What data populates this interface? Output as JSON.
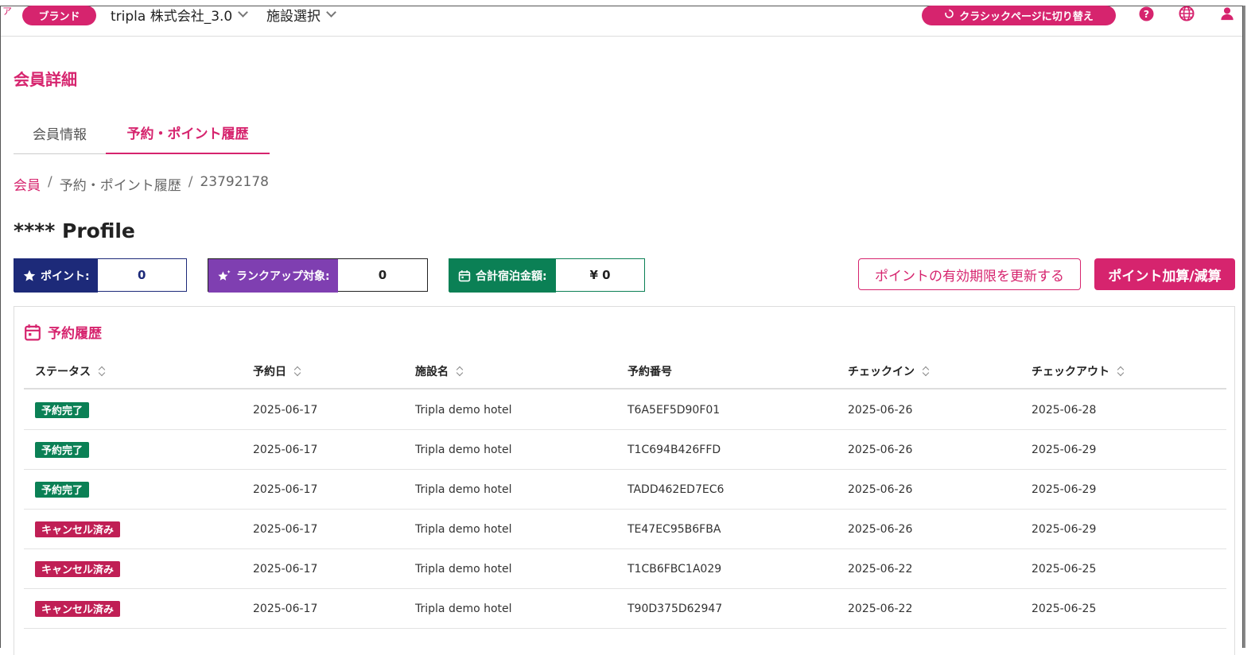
{
  "topbar": {
    "corner_mark": "ア",
    "brand_label": "ブランド",
    "tenant_select": "tripla 株式会社_3.0",
    "facility_select": "施設選択",
    "classic_button": "クラシックページに切り替え",
    "icons": [
      "help-icon",
      "globe-icon",
      "user-icon"
    ]
  },
  "page": {
    "title": "会員詳細",
    "tabs": [
      {
        "label": "会員情報",
        "active": false
      },
      {
        "label": "予約・ポイント履歴",
        "active": true
      }
    ],
    "breadcrumb": [
      "会員",
      "予約・ポイント履歴",
      "23792178"
    ],
    "profile_title": "**** Profile"
  },
  "stats": {
    "points": {
      "label": "ポイント:",
      "value": "0",
      "color": "#1d2a79"
    },
    "rankup": {
      "label": "ランクアップ対象:",
      "value": "0",
      "color": "#7f3fb1"
    },
    "stay_total": {
      "label": "合計宿泊金額:",
      "value": "¥ 0",
      "color": "#0b8055"
    }
  },
  "actions": {
    "extend_points": "ポイントの有効期限を更新する",
    "adjust_points": "ポイント加算/減算"
  },
  "history": {
    "title": "予約履歴",
    "columns": [
      "ステータス",
      "予約日",
      "施設名",
      "予約番号",
      "チェックイン",
      "チェックアウト"
    ],
    "rows": [
      {
        "status": "予約完了",
        "status_type": "done",
        "booked": "2025-06-17",
        "hotel": "Tripla demo hotel",
        "number": "T6A5EF5D90F01",
        "checkin": "2025-06-26",
        "checkout": "2025-06-28"
      },
      {
        "status": "予約完了",
        "status_type": "done",
        "booked": "2025-06-17",
        "hotel": "Tripla demo hotel",
        "number": "T1C694B426FFD",
        "checkin": "2025-06-26",
        "checkout": "2025-06-29"
      },
      {
        "status": "予約完了",
        "status_type": "done",
        "booked": "2025-06-17",
        "hotel": "Tripla demo hotel",
        "number": "TADD462ED7EC6",
        "checkin": "2025-06-26",
        "checkout": "2025-06-29"
      },
      {
        "status": "キャンセル済み",
        "status_type": "cancel",
        "booked": "2025-06-17",
        "hotel": "Tripla demo hotel",
        "number": "TE47EC95B6FBA",
        "checkin": "2025-06-26",
        "checkout": "2025-06-29"
      },
      {
        "status": "キャンセル済み",
        "status_type": "cancel",
        "booked": "2025-06-17",
        "hotel": "Tripla demo hotel",
        "number": "T1CB6FBC1A029",
        "checkin": "2025-06-22",
        "checkout": "2025-06-25"
      },
      {
        "status": "キャンセル済み",
        "status_type": "cancel",
        "booked": "2025-06-17",
        "hotel": "Tripla demo hotel",
        "number": "T90D375D62947",
        "checkin": "2025-06-22",
        "checkout": "2025-06-25"
      }
    ]
  },
  "theme": {
    "accent": "#d6246e"
  }
}
